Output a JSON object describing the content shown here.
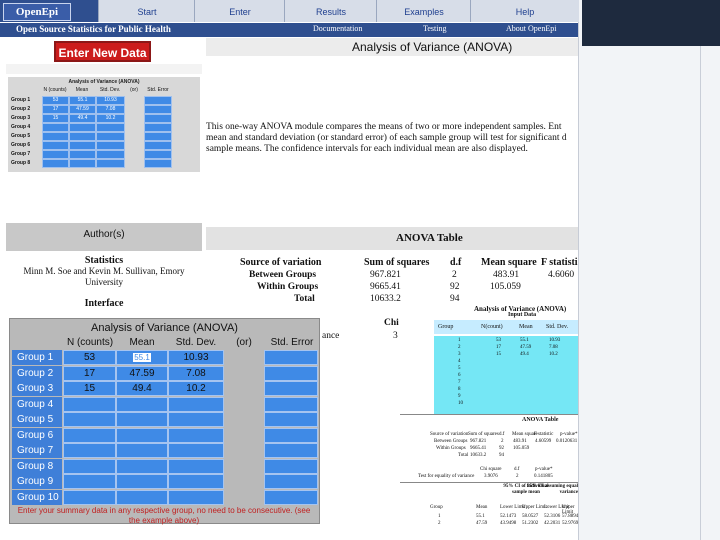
{
  "header": {
    "logo": "OpenEpi",
    "tabs": [
      "Start",
      "Enter",
      "Results",
      "Examples",
      "Help"
    ],
    "subtitle": "Open Source Statistics for Public Health",
    "links": [
      "Documentation",
      "Testing",
      "About OpenEpi"
    ]
  },
  "enter_button_label": "Enter New Data",
  "page_heading": "Analysis of Variance (ANOVA)",
  "small_panel": {
    "title": "Analysis of Variance (ANOVA)",
    "headers": [
      "N (counts)",
      "Mean",
      "Std. Dev.",
      "(or)",
      "Std. Error"
    ],
    "rows": [
      {
        "label": "Group 1",
        "n": "53",
        "mean": "55.1",
        "sd": "10.93"
      },
      {
        "label": "Group 2",
        "n": "17",
        "mean": "47.59",
        "sd": "7.08"
      },
      {
        "label": "Group 3",
        "n": "15",
        "mean": "49.4",
        "sd": "10.2"
      },
      {
        "label": "Group 4",
        "n": "",
        "mean": "",
        "sd": ""
      },
      {
        "label": "Group 5",
        "n": "",
        "mean": "",
        "sd": ""
      },
      {
        "label": "Group 6",
        "n": "",
        "mean": "",
        "sd": ""
      },
      {
        "label": "Group 7",
        "n": "",
        "mean": "",
        "sd": ""
      },
      {
        "label": "Group 8",
        "n": "",
        "mean": "",
        "sd": ""
      }
    ]
  },
  "description": [
    "This one-way ANOVA module compares the means of two or more independent samples. Ent",
    "mean and standard deviation (or standard error) of each sample group will test for significant d",
    "sample means. The confidence intervals for each individual mean are also displayed."
  ],
  "author": {
    "label": "Author(s)",
    "statistics_label": "Statistics",
    "statistics_names": "Minn M. Soe and Kevin M. Sullivan, Emory",
    "statistics_affil": "University",
    "interface_label": "Interface"
  },
  "anova_table": {
    "title": "ANOVA Table",
    "headers": [
      "Source of variation",
      "Sum of squares",
      "d.f",
      "Mean square",
      "F statisti"
    ],
    "rows": [
      {
        "source": "Between Groups",
        "ss": "967.821",
        "df": "2",
        "ms": "483.91",
        "f": "4.6060"
      },
      {
        "source": "Within Groups",
        "ss": "9665.41",
        "df": "92",
        "ms": "105.059",
        "f": ""
      },
      {
        "source": "Total",
        "ss": "10633.2",
        "df": "94",
        "ms": "",
        "f": ""
      }
    ],
    "chi_label": "Chi",
    "ance_label": "ance",
    "ance_value": "3"
  },
  "big_panel": {
    "title": "Analysis of Variance (ANOVA)",
    "headers": [
      "N (counts)",
      "Mean",
      "Std. Dev.",
      "(or)",
      "Std. Error"
    ],
    "rows": [
      {
        "label": "Group 1",
        "n": "53",
        "mean": "55.1",
        "sd": "10.93"
      },
      {
        "label": "Group 2",
        "n": "17",
        "mean": "47.59",
        "sd": "7.08"
      },
      {
        "label": "Group 3",
        "n": "15",
        "mean": "49.4",
        "sd": "10.2"
      },
      {
        "label": "Group 4",
        "n": "",
        "mean": "",
        "sd": ""
      },
      {
        "label": "Group 5",
        "n": "",
        "mean": "",
        "sd": ""
      },
      {
        "label": "Group 6",
        "n": "",
        "mean": "",
        "sd": ""
      },
      {
        "label": "Group 7",
        "n": "",
        "mean": "",
        "sd": ""
      },
      {
        "label": "Group 8",
        "n": "",
        "mean": "",
        "sd": ""
      },
      {
        "label": "Group 9",
        "n": "",
        "mean": "",
        "sd": ""
      },
      {
        "label": "Group 10",
        "n": "",
        "mean": "",
        "sd": ""
      }
    ],
    "note": "Enter your summary data in any respective group, no need to be consecutive. (see the example above)"
  },
  "results_panel": {
    "title": "Analysis of Variance (ANOVA)",
    "subtitle": "Input Data",
    "headers": [
      "Group",
      "N(count)",
      "Mean",
      "Std. Dev.",
      "Std. error"
    ],
    "groups": [
      {
        "g": "1",
        "n": "53",
        "mean": "55.1",
        "sd": "10.93"
      },
      {
        "g": "2",
        "n": "17",
        "mean": "47.59",
        "sd": "7.08"
      },
      {
        "g": "3",
        "n": "15",
        "mean": "49.4",
        "sd": "10.2"
      },
      {
        "g": "4",
        "n": "",
        "mean": "",
        "sd": ""
      },
      {
        "g": "5",
        "n": "",
        "mean": "",
        "sd": ""
      },
      {
        "g": "6",
        "n": "",
        "mean": "",
        "sd": ""
      },
      {
        "g": "7",
        "n": "",
        "mean": "",
        "sd": ""
      },
      {
        "g": "8",
        "n": "",
        "mean": "",
        "sd": ""
      },
      {
        "g": "9",
        "n": "",
        "mean": "",
        "sd": ""
      },
      {
        "g": "10",
        "n": "",
        "mean": "",
        "sd": ""
      }
    ],
    "anova_title": "ANOVA Table",
    "anova_headers": [
      "Source of variation",
      "Sum of squares",
      "d.f",
      "Mean square",
      "F statistic",
      "p-value*"
    ],
    "anova_rows": [
      {
        "source": "Between Groups",
        "ss": "967.821",
        "df": "2",
        "ms": "483.91",
        "f": "4.60599",
        "p": "0.0120631"
      },
      {
        "source": "Within Groups",
        "ss": "9665.41",
        "df": "92",
        "ms": "105.059",
        "f": "",
        "p": ""
      },
      {
        "source": "Total",
        "ss": "10633.2",
        "df": "94",
        "ms": "",
        "f": "",
        "p": ""
      }
    ],
    "chi_headers": [
      "Chi square",
      "d.f",
      "p-value*"
    ],
    "chi_row": {
      "label": "Test for equality of variance",
      "chi": "3.9076",
      "df": "2",
      "p": "0.141805"
    },
    "ci_left": "95% CI of individual sample mean",
    "ci_right": "95% CI assuming equal variance",
    "ci_headers": [
      "Group",
      "Mean",
      "Lower Limit",
      "Upper Limit",
      "Lower Limit",
      "Upper Limit"
    ],
    "ci_rows": [
      {
        "g": "1",
        "mean": "55.1",
        "ll1": "52.1473",
        "ul1": "58.0527",
        "ll2": "52.3106",
        "ul2": "57.8894"
      },
      {
        "g": "2",
        "mean": "47.59",
        "ll1": "43.9498",
        "ul1": "51.2302",
        "ll2": "42.2031",
        "ul2": "52.9769"
      }
    ]
  },
  "colors": {
    "nav": "#2f4f8f",
    "tab": "#d7dde8",
    "button_red": "#cc1c1c",
    "cell_blue": "#3f8ae6",
    "input_cyan": "#75e7f5"
  }
}
